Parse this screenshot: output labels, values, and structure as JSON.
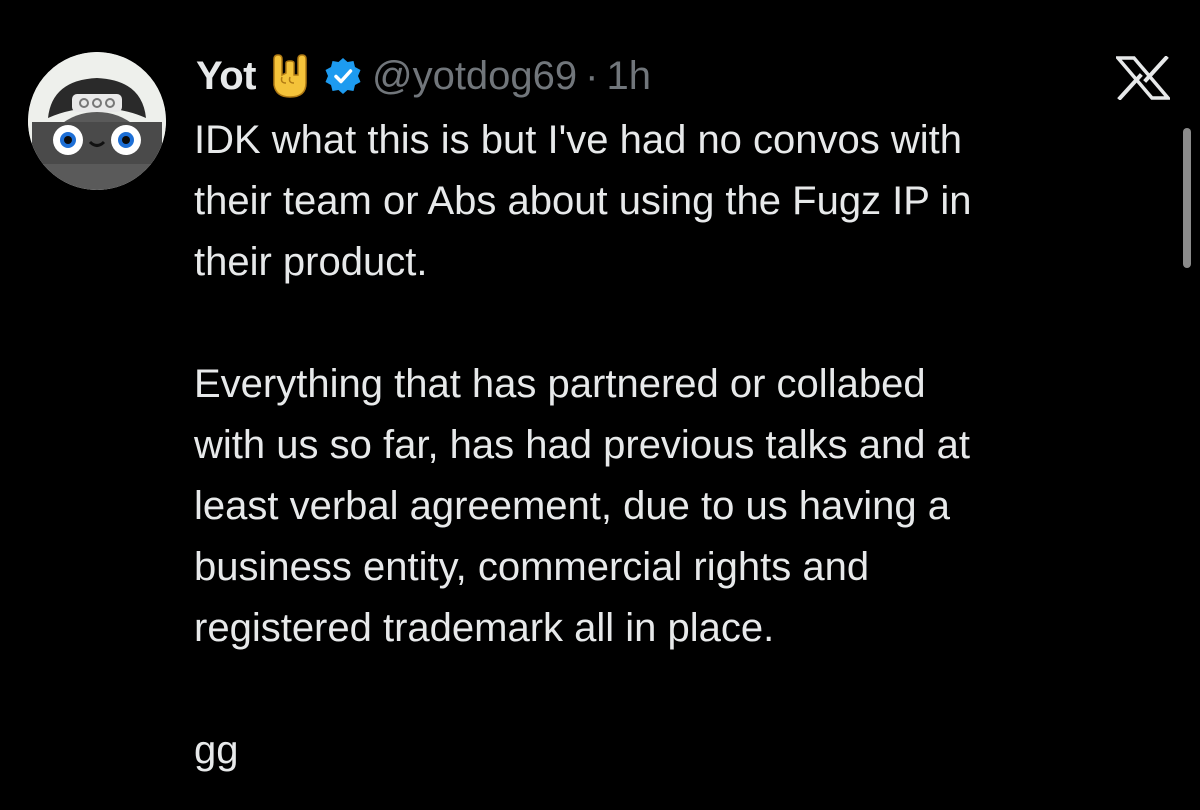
{
  "author": {
    "display_name": "Yot",
    "handle": "@yotdog69",
    "separator": "·",
    "time": "1h",
    "emoji": "sign-of-the-horns-emoji",
    "verified_badge": "verified-badge-icon",
    "avatar": "avatar-cartoon-dog-cap"
  },
  "logo": "x-logo-icon",
  "tweet": {
    "paragraphs": [
      [
        "IDK what this is but I've had no convos with",
        "their team or Abs about using the Fugz IP in",
        "their product."
      ],
      [
        "Everything that has partnered or collabed",
        "with us so far, has had previous talks and at",
        "least verbal agreement, due to us having a",
        "business entity, commercial rights and",
        "registered trademark all in place."
      ],
      [
        "gg"
      ]
    ]
  },
  "colors": {
    "background": "#000000",
    "text": "#e7e9ea",
    "muted": "#71767b",
    "verified": "#1d9bf0"
  }
}
